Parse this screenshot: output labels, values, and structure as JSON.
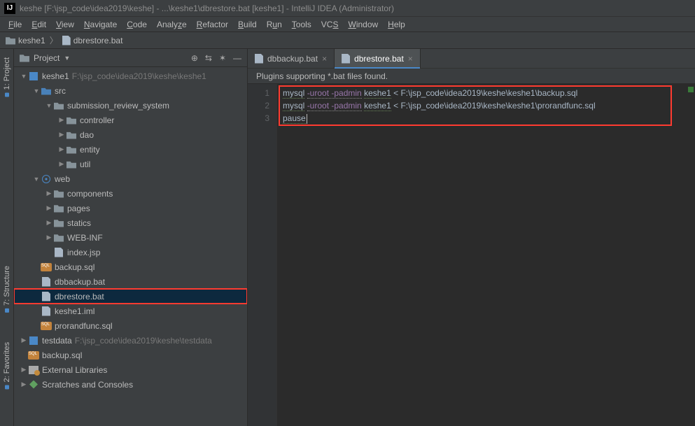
{
  "title": "keshe [F:\\jsp_code\\idea2019\\keshe] - ...\\keshe1\\dbrestore.bat [keshe1] - IntelliJ IDEA (Administrator)",
  "menu": [
    "File",
    "Edit",
    "View",
    "Navigate",
    "Code",
    "Analyze",
    "Refactor",
    "Build",
    "Run",
    "Tools",
    "VCS",
    "Window",
    "Help"
  ],
  "breadcrumbs": [
    {
      "icon": "folder",
      "label": "keshe1"
    },
    {
      "icon": "file",
      "label": "dbrestore.bat"
    }
  ],
  "side_tabs": [
    "1: Project",
    "7: Structure",
    "2: Favorites"
  ],
  "project_panel": {
    "title": "Project",
    "actions": [
      "target",
      "expand",
      "settings",
      "hide"
    ]
  },
  "tree": [
    {
      "depth": 0,
      "arrow": "open",
      "icon": "module",
      "label": "keshe1",
      "extra": "F:\\jsp_code\\idea2019\\keshe\\keshe1"
    },
    {
      "depth": 1,
      "arrow": "open",
      "icon": "src",
      "label": "src"
    },
    {
      "depth": 2,
      "arrow": "open",
      "icon": "pkg",
      "label": "submission_review_system"
    },
    {
      "depth": 3,
      "arrow": "closed",
      "icon": "pkg",
      "label": "controller"
    },
    {
      "depth": 3,
      "arrow": "closed",
      "icon": "pkg",
      "label": "dao"
    },
    {
      "depth": 3,
      "arrow": "closed",
      "icon": "pkg",
      "label": "entity"
    },
    {
      "depth": 3,
      "arrow": "closed",
      "icon": "pkg",
      "label": "util"
    },
    {
      "depth": 1,
      "arrow": "open",
      "icon": "web",
      "label": "web"
    },
    {
      "depth": 2,
      "arrow": "closed",
      "icon": "folder",
      "label": "components"
    },
    {
      "depth": 2,
      "arrow": "closed",
      "icon": "folder",
      "label": "pages"
    },
    {
      "depth": 2,
      "arrow": "closed",
      "icon": "folder",
      "label": "statics"
    },
    {
      "depth": 2,
      "arrow": "closed",
      "icon": "folder",
      "label": "WEB-INF"
    },
    {
      "depth": 2,
      "arrow": "none",
      "icon": "jsp",
      "label": "index.jsp"
    },
    {
      "depth": 1,
      "arrow": "none",
      "icon": "sql",
      "label": "backup.sql"
    },
    {
      "depth": 1,
      "arrow": "none",
      "icon": "file",
      "label": "dbbackup.bat"
    },
    {
      "depth": 1,
      "arrow": "none",
      "icon": "file",
      "label": "dbrestore.bat",
      "selected": true,
      "red": true
    },
    {
      "depth": 1,
      "arrow": "none",
      "icon": "file",
      "label": "keshe1.iml"
    },
    {
      "depth": 1,
      "arrow": "none",
      "icon": "sql",
      "label": "prorandfunc.sql"
    },
    {
      "depth": 0,
      "arrow": "closed",
      "icon": "module",
      "label": "testdata",
      "extra": "F:\\jsp_code\\idea2019\\keshe\\testdata"
    },
    {
      "depth": 0,
      "arrow": "none",
      "icon": "sql",
      "label": "backup.sql"
    },
    {
      "depth": 0,
      "arrow": "closed",
      "icon": "lib",
      "label": "External Libraries"
    },
    {
      "depth": 0,
      "arrow": "closed",
      "icon": "scratch",
      "label": "Scratches and Consoles"
    }
  ],
  "editor_tabs": [
    {
      "label": "dbbackup.bat",
      "active": false
    },
    {
      "label": "dbrestore.bat",
      "active": true
    }
  ],
  "notice": "Plugins supporting *.bat files found.",
  "code_lines": [
    {
      "n": "1",
      "cmd": "mysql",
      "opts": "-uroot -padmin",
      "arg": "keshe1",
      "rest": " < F:\\jsp_code\\idea2019\\keshe\\keshe1\\backup.sql"
    },
    {
      "n": "2",
      "cmd": "mysql",
      "opts": "-uroot -padmin",
      "arg": "keshe1",
      "rest": " < F:\\jsp_code\\idea2019\\keshe\\keshe1\\prorandfunc.sql"
    },
    {
      "n": "3",
      "cmd": "pause",
      "opts": "",
      "arg": "",
      "rest": ""
    }
  ]
}
